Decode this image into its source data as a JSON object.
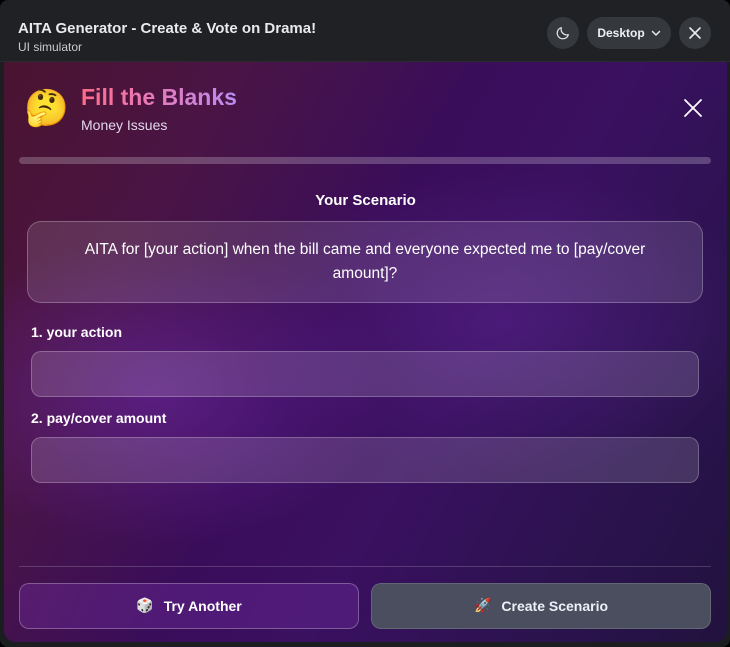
{
  "window": {
    "title": "AITA Generator - Create & Vote on Drama!",
    "subtitle": "UI simulator",
    "view_mode": "Desktop",
    "icons": {
      "theme": "moon-icon",
      "view_dropdown": "chevron-down-icon",
      "close": "close-icon"
    }
  },
  "modal": {
    "emoji": "🤔",
    "heading": "Fill the Blanks",
    "category": "Money Issues",
    "progress": 0,
    "section_label": "Your Scenario",
    "scenario_text": "AITA for [your action] when the bill came and everyone expected me to [pay/cover amount]?",
    "fields": [
      {
        "label": "1. your action",
        "value": "",
        "placeholder": ""
      },
      {
        "label": "2. pay/cover amount",
        "value": "",
        "placeholder": ""
      }
    ],
    "buttons": {
      "try_icon": "🎲",
      "try_label": "Try Another",
      "create_icon": "🚀",
      "create_label": "Create Scenario"
    },
    "colors": {
      "heading_gradient_start": "#ff6a88",
      "heading_gradient_end": "#b98cf2",
      "create_button_bg": "#4a4e5f"
    }
  }
}
